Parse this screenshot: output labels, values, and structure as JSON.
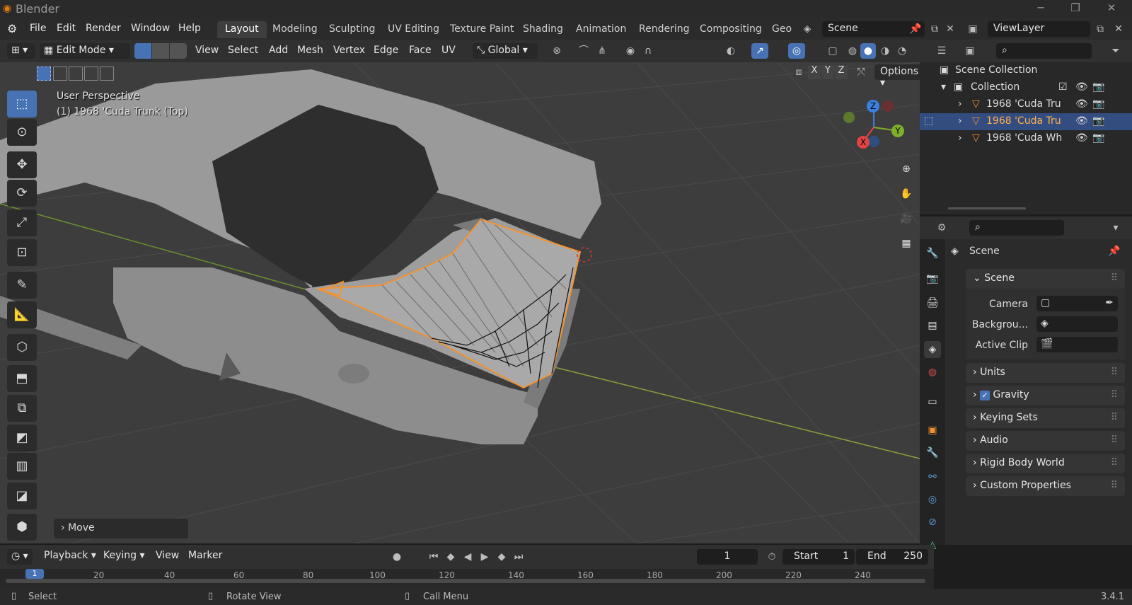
{
  "window": {
    "title": "Blender",
    "controls": [
      "minimize-icon",
      "maximize-icon",
      "close-icon"
    ]
  },
  "menu": {
    "items": [
      "File",
      "Edit",
      "Render",
      "Window",
      "Help"
    ]
  },
  "workspaces": {
    "tabs": [
      "Layout",
      "Modeling",
      "Sculpting",
      "UV Editing",
      "Texture Paint",
      "Shading",
      "Animation",
      "Rendering",
      "Compositing",
      "Geo"
    ],
    "active": "Layout"
  },
  "scene_field": "Scene",
  "viewlayer_field": "ViewLayer",
  "viewport_header": {
    "mode": "Edit Mode",
    "menus": [
      "View",
      "Select",
      "Add",
      "Mesh",
      "Vertex",
      "Edge",
      "Face",
      "UV"
    ],
    "transform_orientation": "Global",
    "axes": [
      "X",
      "Y",
      "Z"
    ],
    "options": "Options"
  },
  "viewport_overlay": {
    "perspective": "User Perspective",
    "object": "(1) 1968 'Cuda Trunk (Top)",
    "last_op": "Move"
  },
  "gizmo_axes": {
    "x": "X",
    "y": "Y",
    "z": "Z"
  },
  "outliner": {
    "root": "Scene Collection",
    "collection": "Collection",
    "objects": [
      {
        "name": "1968 'Cuda Tru",
        "selected": false
      },
      {
        "name": "1968 'Cuda Tru",
        "selected": true
      },
      {
        "name": "1968 'Cuda Wh",
        "selected": false
      }
    ]
  },
  "properties": {
    "context": "Scene",
    "panel_scene": "Scene",
    "labels": {
      "camera": "Camera",
      "background": "Backgrou...",
      "active_clip": "Active Clip"
    },
    "panels": [
      "Units",
      "Gravity",
      "Keying Sets",
      "Audio",
      "Rigid Body World",
      "Custom Properties"
    ],
    "gravity_checked": true
  },
  "timeline": {
    "menus": [
      "Playback",
      "Keying",
      "View",
      "Marker"
    ],
    "current_frame": "1",
    "start_label": "Start",
    "start": "1",
    "end_label": "End",
    "end": "250",
    "ticks": [
      "1",
      "20",
      "40",
      "60",
      "80",
      "100",
      "120",
      "140",
      "160",
      "180",
      "200",
      "220",
      "240"
    ]
  },
  "statusbar": {
    "select": "Select",
    "rotate": "Rotate View",
    "call_menu": "Call Menu",
    "version": "3.4.1"
  },
  "colors": {
    "accent": "#4772b3",
    "selected_orange": "#f5922e",
    "x_axis": "#e04444",
    "y_axis": "#7fae2b",
    "z_axis": "#3a80e0"
  }
}
